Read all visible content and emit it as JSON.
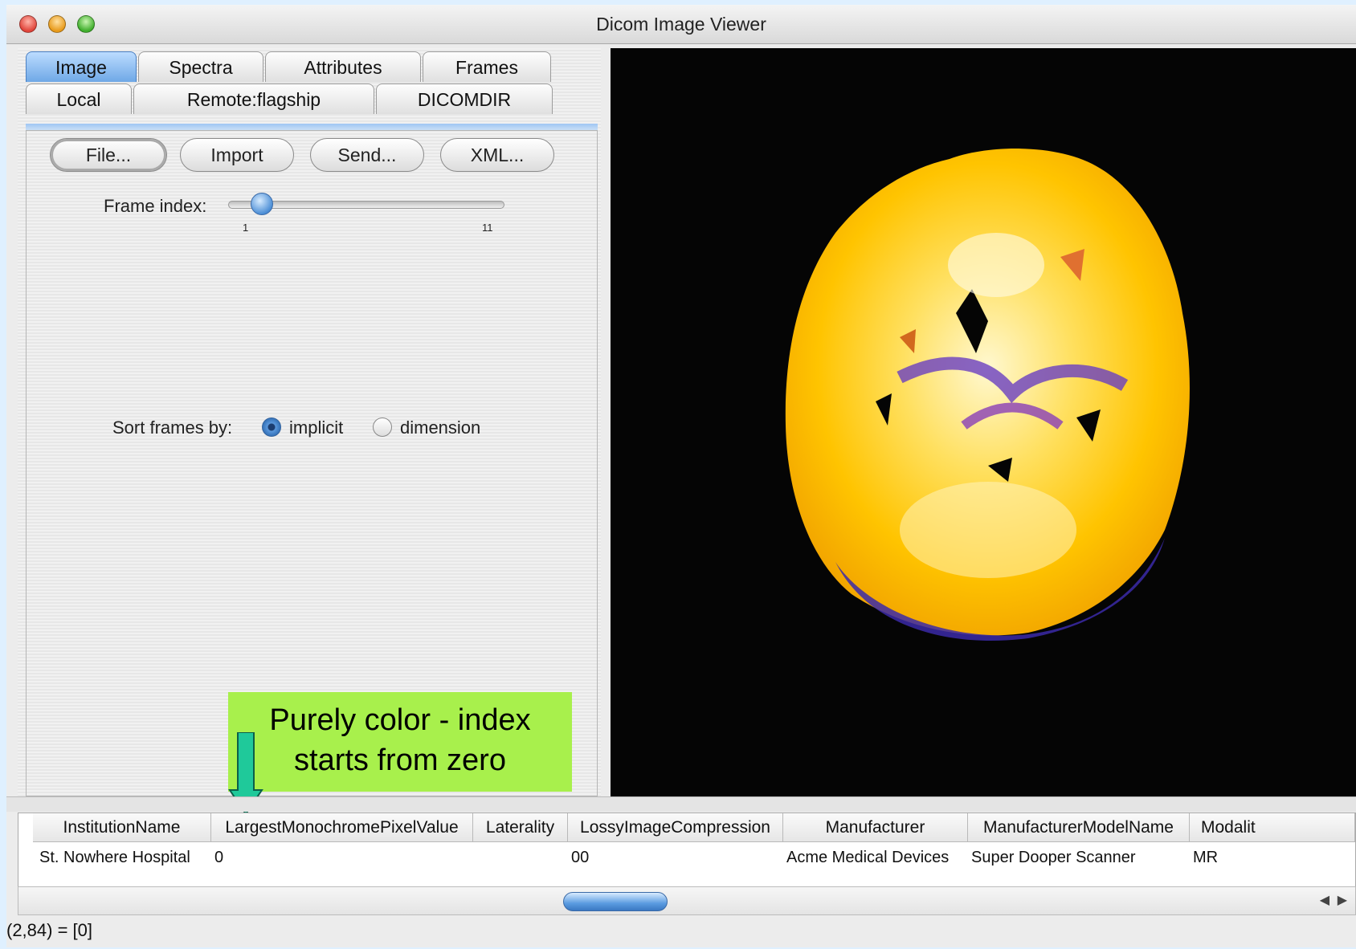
{
  "window": {
    "title": "Dicom Image Viewer"
  },
  "tabs": {
    "row1": [
      {
        "label": "Image",
        "active": true
      },
      {
        "label": "Spectra",
        "active": false
      },
      {
        "label": "Attributes",
        "active": false
      },
      {
        "label": "Frames",
        "active": false
      }
    ],
    "row2": [
      {
        "label": "Local",
        "active": false
      },
      {
        "label": "Remote:flagship",
        "active": false
      },
      {
        "label": "DICOMDIR",
        "active": false
      }
    ]
  },
  "buttons": {
    "file": "File...",
    "import": "Import",
    "send": "Send...",
    "xml": "XML..."
  },
  "frame_index": {
    "label": "Frame index:",
    "min_label": "1",
    "max_label": "11",
    "value": 2,
    "min": 1,
    "max": 11
  },
  "sort": {
    "label": "Sort frames by:",
    "options": [
      "implicit",
      "dimension"
    ],
    "selected": "implicit"
  },
  "callout": {
    "line1": "Purely color - index",
    "line2": "starts from zero",
    "color": "#a8f04c",
    "arrow_color": "#1fc99a"
  },
  "table": {
    "headers": [
      "InstitutionName",
      "LargestMonochromePixelValue",
      "Laterality",
      "LossyImageCompression",
      "Manufacturer",
      "ManufacturerModelName",
      "Modalit"
    ],
    "row": [
      "St. Nowhere Hospital",
      "0",
      "",
      "00",
      "Acme Medical Devices",
      "Super Dooper Scanner",
      "MR"
    ]
  },
  "status": {
    "text": "(2,84) =  [0]"
  },
  "colors": {
    "accent": "#5a9be0",
    "image_bg": "#050505"
  }
}
